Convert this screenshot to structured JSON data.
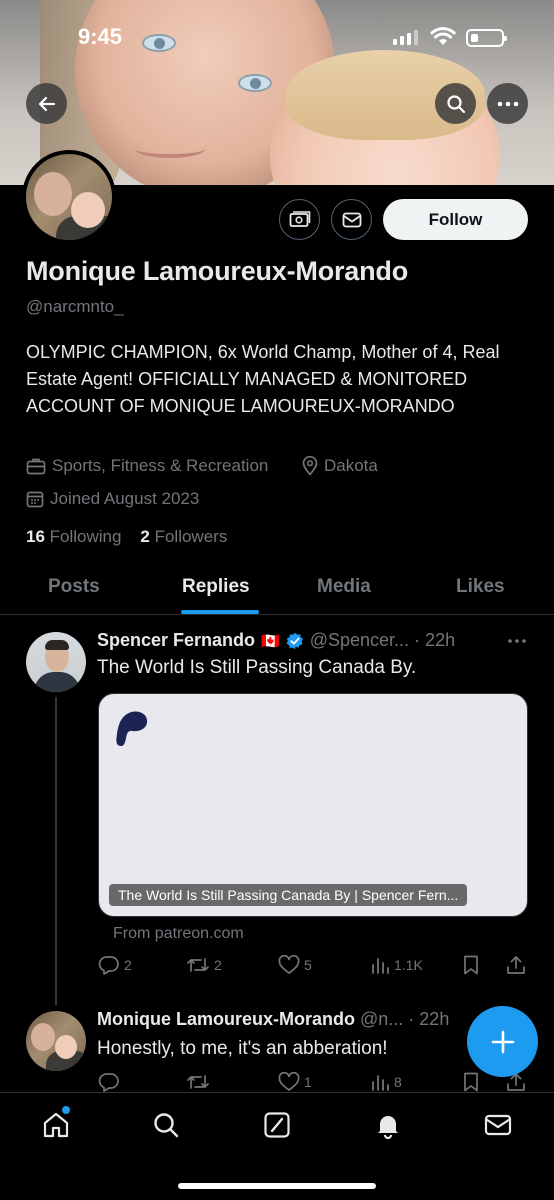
{
  "status_bar": {
    "time": "9:45"
  },
  "profile": {
    "display_name": "Monique Lamoureux-Morando",
    "handle": "@narcmnto_",
    "bio": "OLYMPIC CHAMPION, 6x World Champ, Mother of 4, Real Estate Agent! OFFICIALLY MANAGED & MONITORED ACCOUNT OF MONIQUE LAMOUREUX-MORANDO",
    "category": "Sports, Fitness & Recreation",
    "location": "Dakota",
    "joined": "Joined August 2023",
    "following_count": "16",
    "following_label": "Following",
    "followers_count": "2",
    "followers_label": "Followers",
    "follow_button": "Follow"
  },
  "tabs": [
    {
      "label": "Posts"
    },
    {
      "label": "Replies",
      "active": true
    },
    {
      "label": "Media"
    },
    {
      "label": "Likes"
    }
  ],
  "posts": [
    {
      "author": "Spencer Fernando",
      "flag": "🇨🇦",
      "verified": true,
      "handle_time": "@Spencer... · 22h",
      "text": "The World Is Still Passing Canada By.",
      "card_title": "The World Is Still Passing Canada By | Spencer Fern...",
      "card_source": "From patreon.com",
      "replies": "2",
      "reposts": "2",
      "likes": "5",
      "views": "1.1K"
    },
    {
      "author": "Monique Lamoureux-Morando",
      "handle_time": "@n... · 22h",
      "text": "Honestly, to me, it's an abberation!",
      "replies": "",
      "reposts": "",
      "likes": "1",
      "views": "8"
    }
  ],
  "colors": {
    "accent": "#1d9bf0",
    "background": "#000000",
    "secondary_text": "#71767b",
    "primary_text": "#e7e9ea"
  },
  "icons": {
    "back": "arrow-left-icon",
    "search": "search-icon",
    "more": "more-horizontal-icon",
    "money": "money-icon",
    "message": "envelope-icon",
    "compose": "plus-icon"
  }
}
